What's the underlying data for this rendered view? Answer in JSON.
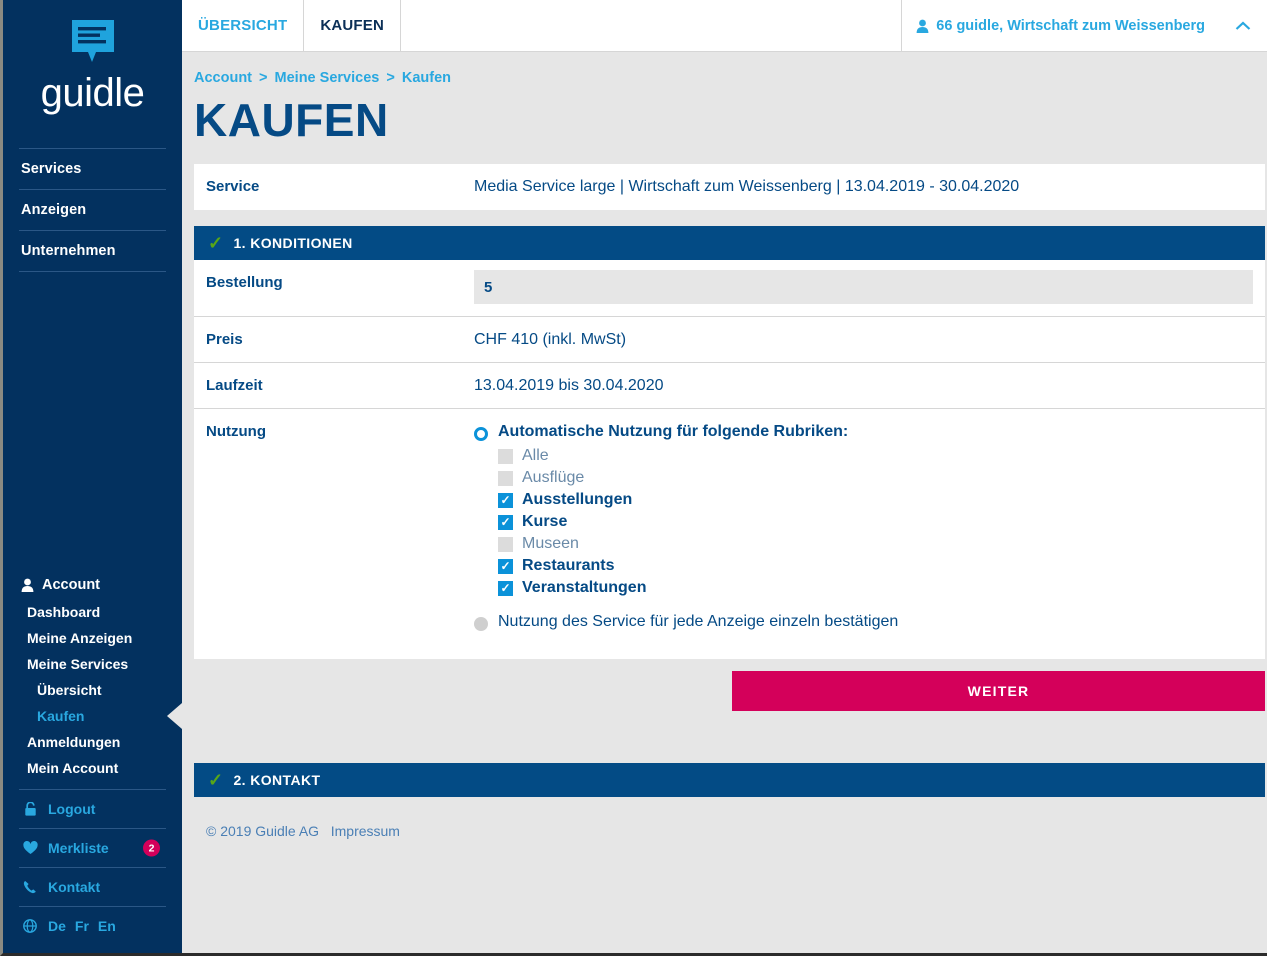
{
  "brand": {
    "name": "guidle",
    "logo_icon": "speech-bubble-icon",
    "primary_navy": "#03315f",
    "accent_blue": "#29a8e0",
    "accent_pink": "#d4005a",
    "header_blue": "#034b85",
    "check_green": "#58a618"
  },
  "sidebar": {
    "top_nav": [
      {
        "label": "Services"
      },
      {
        "label": "Anzeigen"
      },
      {
        "label": "Unternehmen"
      }
    ],
    "account_heading": {
      "label": "Account",
      "icon": "user-icon"
    },
    "account_items": [
      {
        "label": "Dashboard",
        "level": 1,
        "active": false
      },
      {
        "label": "Meine Anzeigen",
        "level": 1,
        "active": false
      },
      {
        "label": "Meine Services",
        "level": 1,
        "active": false
      },
      {
        "label": "Übersicht",
        "level": 2,
        "active": false
      },
      {
        "label": "Kaufen",
        "level": 2,
        "active": true
      }
    ],
    "account_items_tail": [
      {
        "label": "Anmeldungen",
        "level": 1,
        "active": false
      },
      {
        "label": "Mein Account",
        "level": 1,
        "active": false
      }
    ],
    "utilities": [
      {
        "label": "Logout",
        "icon": "lock-icon",
        "badge": null
      },
      {
        "label": "Merkliste",
        "icon": "heart-icon",
        "badge": "2"
      },
      {
        "label": "Kontakt",
        "icon": "phone-icon",
        "badge": null
      }
    ],
    "languages": {
      "icon": "globe-icon",
      "items": [
        "De",
        "Fr",
        "En"
      ]
    }
  },
  "topbar": {
    "tabs": [
      {
        "label": "ÜBERSICHT",
        "active": false
      },
      {
        "label": "KAUFEN",
        "active": true
      }
    ],
    "user": {
      "icon": "user-icon",
      "label": "66 guidle, Wirtschaft zum Weissenberg"
    },
    "collapse_icon": "chevron-up-icon"
  },
  "breadcrumb": {
    "items": [
      "Account",
      "Meine Services",
      "Kaufen"
    ],
    "separator": ">"
  },
  "page": {
    "title": "KAUFEN"
  },
  "service_row": {
    "label": "Service",
    "value": "Media Service large | Wirtschaft zum Weissenberg | 13.04.2019 - 30.04.2020"
  },
  "section1": {
    "title": "1. KONDITIONEN",
    "check_icon": "check-icon",
    "rows": {
      "bestellung": {
        "label": "Bestellung",
        "value": "5"
      },
      "preis": {
        "label": "Preis",
        "value": "CHF 410 (inkl. MwSt)"
      },
      "laufzeit": {
        "label": "Laufzeit",
        "value": "13.04.2019 bis 30.04.2020"
      },
      "nutzung": {
        "label": "Nutzung",
        "option_auto": {
          "label": "Automatische Nutzung für folgende Rubriken:",
          "selected": true
        },
        "rubriken": [
          {
            "label": "Alle",
            "checked": false
          },
          {
            "label": "Ausflüge",
            "checked": false
          },
          {
            "label": "Ausstellungen",
            "checked": true
          },
          {
            "label": "Kurse",
            "checked": true
          },
          {
            "label": "Museen",
            "checked": false
          },
          {
            "label": "Restaurants",
            "checked": true
          },
          {
            "label": "Veranstaltungen",
            "checked": true
          }
        ],
        "option_manual": {
          "label": "Nutzung des Service für jede Anzeige einzeln bestätigen",
          "selected": false
        }
      }
    },
    "primary_button": "WEITER"
  },
  "section2": {
    "title": "2. KONTAKT",
    "check_icon": "check-icon"
  },
  "footer": {
    "copyright": "© 2019 Guidle AG",
    "impressum": "Impressum"
  },
  "glyphs": {
    "check_tick": "✓",
    "checkbox_tick": "✓",
    "chevron_up": "⌃"
  }
}
